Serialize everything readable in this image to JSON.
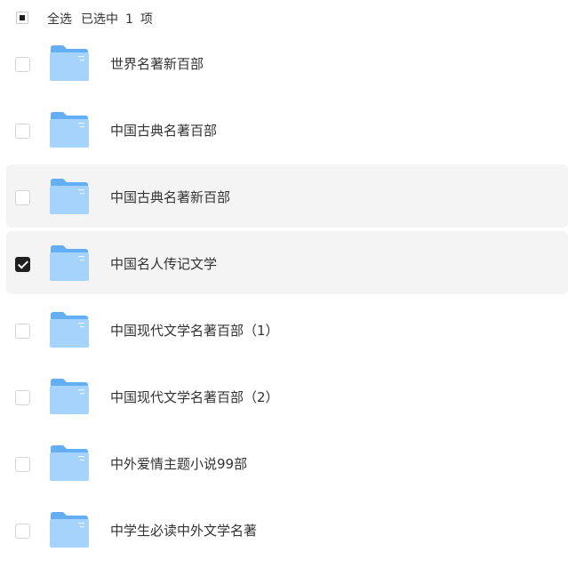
{
  "header": {
    "select_all_label": "全选",
    "selected_prefix": "已选中",
    "selected_count": "1",
    "selected_suffix": "项"
  },
  "colors": {
    "folder_back": "#64aef5",
    "folder_front": "#a6d3fb",
    "selected_row_bg": "#f4f4f4",
    "checkbox_checked": "#1f1f1f"
  },
  "items": [
    {
      "name": "世界名著新百部",
      "checked": false,
      "highlighted": false,
      "icon": "folder-icon"
    },
    {
      "name": "中国古典名著百部",
      "checked": false,
      "highlighted": false,
      "icon": "folder-icon"
    },
    {
      "name": "中国古典名著新百部",
      "checked": false,
      "highlighted": true,
      "icon": "folder-icon"
    },
    {
      "name": "中国名人传记文学",
      "checked": true,
      "highlighted": true,
      "icon": "folder-icon"
    },
    {
      "name": "中国现代文学名著百部（1）",
      "checked": false,
      "highlighted": false,
      "icon": "folder-icon"
    },
    {
      "name": "中国现代文学名著百部（2）",
      "checked": false,
      "highlighted": false,
      "icon": "folder-icon"
    },
    {
      "name": "中外爱情主题小说99部",
      "checked": false,
      "highlighted": false,
      "icon": "folder-icon"
    },
    {
      "name": "中学生必读中外文学名著",
      "checked": false,
      "highlighted": false,
      "icon": "folder-icon"
    }
  ]
}
